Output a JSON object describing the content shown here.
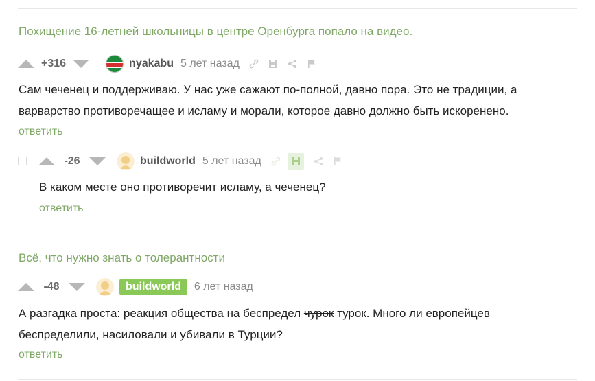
{
  "thread1": {
    "story_title": "Похищение 16-летней школьницы в центре Оренбурга попало на видео.",
    "comment": {
      "rating": "+316",
      "author": "nyakabu",
      "time": "5 лет назад",
      "text_line1": "Сам чеченец и поддерживаю. У нас уже сажают по-полной, давно пора. Это не традиции, а",
      "text_line2": "варварство противоречащее и исламу и морали, которое давно должно быть искоренено.",
      "reply_label": "ответить"
    },
    "reply": {
      "rating": "-26",
      "author": "buildworld",
      "time": "5 лет назад",
      "text": "В каком месте оно противоречит исламу, а чеченец?",
      "reply_label": "ответить"
    }
  },
  "thread2": {
    "story_title": "Всё, что нужно знать о толерантности",
    "comment": {
      "rating": "-48",
      "author": "buildworld",
      "time": "6 лет назад",
      "text_before": "А разгадка проста: реакция общества на беспредел ",
      "text_struck": "чурок",
      "text_after": " турок. Много ли европейцев",
      "text_line2": "беспределили, насиловали и убивали в Турции?",
      "reply_label": "ответить"
    }
  },
  "icons": [
    "upvote-arrow-icon",
    "downvote-arrow-icon",
    "link-icon",
    "save-icon",
    "share-icon",
    "flag-icon",
    "collapse-icon"
  ],
  "colors": {
    "accent_green": "#7fa866",
    "badge_green": "#8ac858",
    "muted": "#b7b7b7"
  }
}
